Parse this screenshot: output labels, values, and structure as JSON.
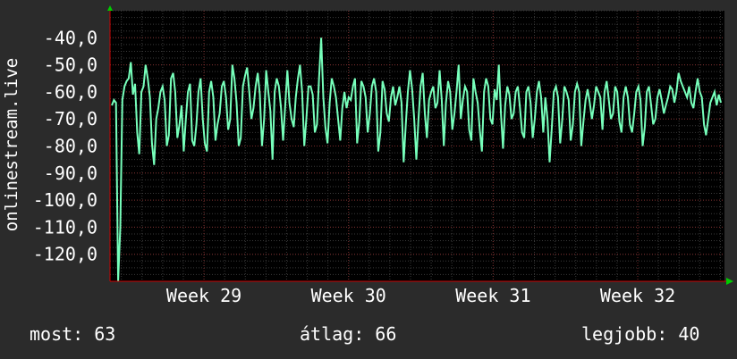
{
  "chart_data": {
    "type": "line",
    "ylabel": "onlinestream.live",
    "y_ticks": [
      "-40,0",
      "-50,0",
      "-60,0",
      "-70,0",
      "-80,0",
      "-90,0",
      "-100,0",
      "-110,0",
      "-120,0"
    ],
    "y_tick_values": [
      -40,
      -50,
      -60,
      -70,
      -80,
      -90,
      -100,
      -110,
      -120
    ],
    "ylim": [
      -130,
      -30
    ],
    "x_ticks": [
      "Week 29",
      "Week 30",
      "Week 31",
      "Week 32"
    ],
    "x_tick_positions": [
      29,
      30,
      31,
      32
    ],
    "xlim": [
      28.35,
      32.6
    ],
    "grid": true,
    "colors": {
      "background": "#2b2b2b",
      "plot": "#000000",
      "line": "#77ffbb",
      "grid": "#555555",
      "axis": "#cc0000",
      "text": "#ffffff",
      "arrow": "#00cc00"
    },
    "series": [
      {
        "values": [
          -65,
          -63,
          -64,
          -130,
          -110,
          -63,
          -58,
          -56,
          -55,
          -49,
          -61,
          -57,
          -75,
          -83,
          -60,
          -58,
          -50,
          -55,
          -62,
          -79,
          -87,
          -70,
          -66,
          -60,
          -58,
          -63,
          -80,
          -76,
          -55,
          -53,
          -60,
          -77,
          -72,
          -65,
          -82,
          -70,
          -60,
          -57,
          -78,
          -80,
          -72,
          -60,
          -55,
          -70,
          -79,
          -82,
          -60,
          -56,
          -62,
          -78,
          -72,
          -68,
          -58,
          -56,
          -62,
          -74,
          -70,
          -50,
          -55,
          -64,
          -80,
          -77,
          -58,
          -54,
          -51,
          -60,
          -70,
          -66,
          -58,
          -53,
          -61,
          -80,
          -70,
          -52,
          -60,
          -67,
          -85,
          -60,
          -55,
          -58,
          -66,
          -78,
          -65,
          -52,
          -64,
          -70,
          -73,
          -62,
          -55,
          -50,
          -60,
          -80,
          -70,
          -58,
          -58,
          -61,
          -75,
          -72,
          -55,
          -40,
          -62,
          -73,
          -79,
          -64,
          -55,
          -58,
          -62,
          -70,
          -78,
          -66,
          -60,
          -66,
          -62,
          -63,
          -58,
          -55,
          -79,
          -71,
          -56,
          -58,
          -62,
          -75,
          -68,
          -58,
          -55,
          -60,
          -82,
          -75,
          -56,
          -59,
          -68,
          -71,
          -62,
          -58,
          -65,
          -62,
          -58,
          -64,
          -86,
          -72,
          -60,
          -52,
          -59,
          -70,
          -85,
          -70,
          -58,
          -53,
          -68,
          -77,
          -63,
          -60,
          -58,
          -66,
          -64,
          -52,
          -63,
          -80,
          -64,
          -56,
          -60,
          -74,
          -68,
          -60,
          -50,
          -70,
          -63,
          -58,
          -60,
          -74,
          -78,
          -55,
          -60,
          -64,
          -74,
          -82,
          -60,
          -55,
          -58,
          -70,
          -72,
          -59,
          -63,
          -50,
          -68,
          -81,
          -65,
          -58,
          -61,
          -70,
          -68,
          -60,
          -58,
          -66,
          -75,
          -77,
          -60,
          -58,
          -64,
          -77,
          -70,
          -60,
          -56,
          -62,
          -75,
          -62,
          -70,
          -86,
          -74,
          -60,
          -58,
          -62,
          -79,
          -70,
          -58,
          -60,
          -63,
          -78,
          -72,
          -60,
          -57,
          -60,
          -80,
          -71,
          -63,
          -59,
          -64,
          -70,
          -65,
          -58,
          -60,
          -62,
          -74,
          -60,
          -56,
          -63,
          -70,
          -68,
          -58,
          -60,
          -71,
          -75,
          -62,
          -58,
          -62,
          -72,
          -75,
          -68,
          -60,
          -58,
          -63,
          -80,
          -73,
          -60,
          -58,
          -65,
          -72,
          -70,
          -62,
          -59,
          -63,
          -68,
          -65,
          -62,
          -58,
          -59,
          -64,
          -60,
          -53,
          -56,
          -58,
          -60,
          -62,
          -58,
          -64,
          -66,
          -60,
          -55,
          -60,
          -62,
          -72,
          -76,
          -70,
          -64,
          -62,
          -60,
          -65,
          -61,
          -64
        ]
      }
    ]
  },
  "stats": {
    "current": "most: 63",
    "average": "átlag: 66",
    "best": "legjobb: 40"
  }
}
